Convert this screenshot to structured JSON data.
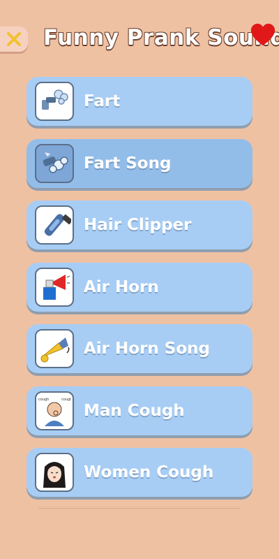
{
  "header": {
    "title": "Funny Prank Sound",
    "close_icon": "close-x-icon",
    "favorite_icon": "heart-icon"
  },
  "items": [
    {
      "label": "Fart",
      "icon": "fart-icon"
    },
    {
      "label": "Fart Song",
      "icon": "fart-song-icon"
    },
    {
      "label": "Hair Clipper",
      "icon": "hair-clipper-icon"
    },
    {
      "label": "Air Horn",
      "icon": "air-horn-icon"
    },
    {
      "label": "Air Horn Song",
      "icon": "air-horn-song-icon"
    },
    {
      "label": "Man Cough",
      "icon": "man-cough-icon"
    },
    {
      "label": "Women Cough",
      "icon": "women-cough-icon"
    }
  ],
  "colors": {
    "background": "#efc1a3",
    "item": "#a7cdf5",
    "item_active": "#93bde9",
    "heart": "#e01818",
    "close_x": "#f2c12e"
  }
}
